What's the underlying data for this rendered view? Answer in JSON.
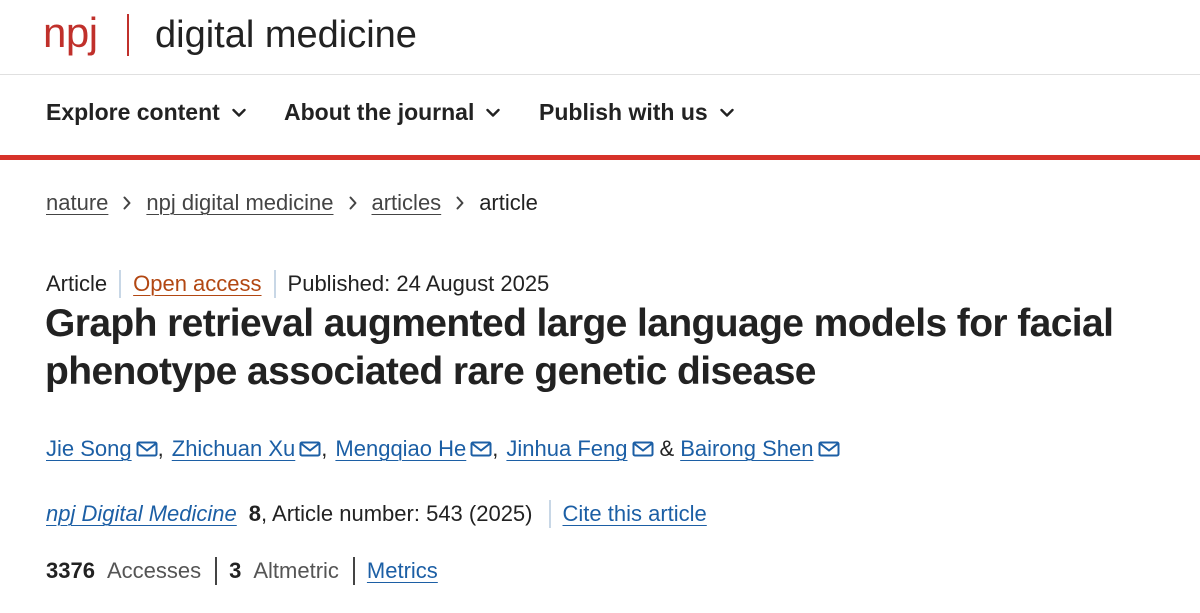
{
  "brand": {
    "logo_text": "npj",
    "journal_title": "digital medicine"
  },
  "nav": {
    "items": [
      {
        "label": "Explore content"
      },
      {
        "label": "About the journal"
      },
      {
        "label": "Publish with us"
      }
    ]
  },
  "breadcrumb": {
    "items": [
      "nature",
      "npj digital medicine",
      "articles"
    ],
    "current": "article"
  },
  "meta": {
    "type": "Article",
    "access": "Open access",
    "published": "Published: 24 August 2025"
  },
  "article": {
    "title": "Graph retrieval augmented large language models for facial phenotype associated rare genetic disease"
  },
  "authors": {
    "list": [
      "Jie Song",
      "Zhichuan Xu",
      "Mengqiao He",
      "Jinhua Feng",
      "Bairong Shen"
    ],
    "separator": ",",
    "conjunction": "&"
  },
  "citation": {
    "journal": "npj Digital Medicine",
    "volume": "8",
    "article_number": ", Article number: 543 (2025)",
    "cite_label": "Cite this article"
  },
  "metrics": {
    "accesses_value": "3376",
    "accesses_label": "Accesses",
    "altmetric_value": "3",
    "altmetric_label": "Altmetric",
    "metrics_link": "Metrics"
  },
  "icons": {
    "nav_chevron": "chevron-down-icon",
    "breadcrumb_separator": "chevron-right-icon",
    "author_contact": "mail-icon"
  },
  "colors": {
    "brand_red": "#c0302b",
    "nav_border": "#d7322a",
    "link_blue": "#1c5fa5",
    "open_access_orange": "#b24712"
  }
}
